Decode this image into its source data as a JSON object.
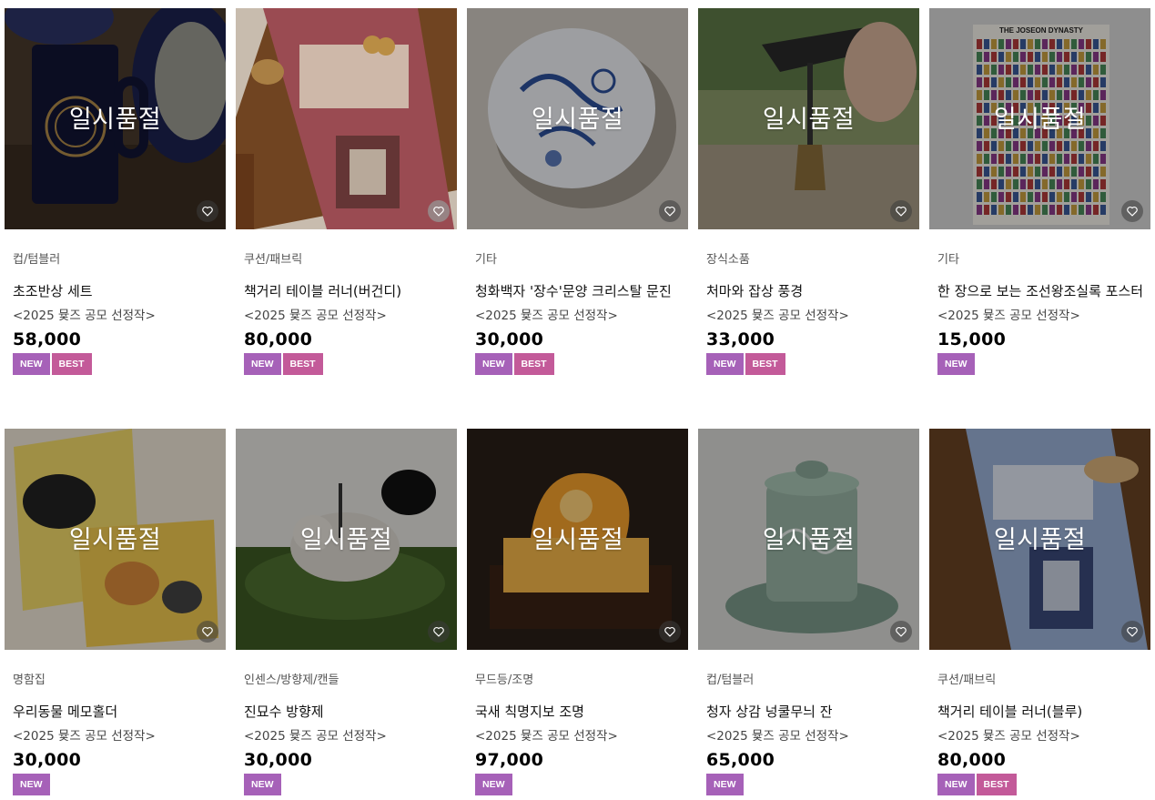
{
  "soldout_label": "일시품절",
  "colors": {
    "new_badge": "#a661b8",
    "best_badge": "#c35a99"
  },
  "products": [
    {
      "category": "컵/텀블러",
      "name": "초조반상 세트",
      "subtitle": "<2025 뮻즈 공모 선정작>",
      "price": "58,000",
      "badges": [
        "NEW",
        "BEST"
      ],
      "soldout": true,
      "icon": "heart-icon"
    },
    {
      "category": "쿠션/패브릭",
      "name": "책거리 테이블 러너(버건디)",
      "subtitle": "<2025 뮻즈 공모 선정작>",
      "price": "80,000",
      "badges": [
        "NEW",
        "BEST"
      ],
      "soldout": false,
      "icon": "heart-icon"
    },
    {
      "category": "기타",
      "name": "청화백자 '장수'문양 크리스탈 문진",
      "subtitle": "<2025 뮻즈 공모 선정작>",
      "price": "30,000",
      "badges": [
        "NEW",
        "BEST"
      ],
      "soldout": true,
      "icon": "heart-icon"
    },
    {
      "category": "장식소품",
      "name": "처마와 잡상 풍경",
      "subtitle": "<2025 뮻즈 공모 선정작>",
      "price": "33,000",
      "badges": [
        "NEW",
        "BEST"
      ],
      "soldout": true,
      "icon": "heart-icon"
    },
    {
      "category": "기타",
      "name": "한 장으로 보는 조선왕조실록 포스터",
      "subtitle": "<2025 뮻즈 공모 선정작>",
      "price": "15,000",
      "badges": [
        "NEW"
      ],
      "soldout": true,
      "poster_title": "THE JOSEON DYNASTY",
      "icon": "heart-icon"
    },
    {
      "category": "명함집",
      "name": "우리동물 메모홀더",
      "subtitle": "<2025 뮻즈 공모 선정작>",
      "price": "30,000",
      "badges": [
        "NEW"
      ],
      "soldout": true,
      "icon": "heart-icon"
    },
    {
      "category": "인센스/방향제/캔들",
      "name": "진묘수 방향제",
      "subtitle": "<2025 뮻즈 공모 선정작>",
      "price": "30,000",
      "badges": [
        "NEW"
      ],
      "soldout": true,
      "icon": "heart-icon"
    },
    {
      "category": "무드등/조명",
      "name": "국새 칙명지보 조명",
      "subtitle": "<2025 뮻즈 공모 선정작>",
      "price": "97,000",
      "badges": [
        "NEW"
      ],
      "soldout": true,
      "icon": "heart-icon"
    },
    {
      "category": "컵/텀블러",
      "name": "청자 상감 넝쿨무늬 잔",
      "subtitle": "<2025 뮻즈 공모 선정작>",
      "price": "65,000",
      "badges": [
        "NEW"
      ],
      "soldout": true,
      "icon": "heart-icon"
    },
    {
      "category": "쿠션/패브릭",
      "name": "책거리 테이블 러너(블루)",
      "subtitle": "<2025 뮻즈 공모 선정작>",
      "price": "80,000",
      "badges": [
        "NEW",
        "BEST"
      ],
      "soldout": true,
      "icon": "heart-icon"
    }
  ]
}
